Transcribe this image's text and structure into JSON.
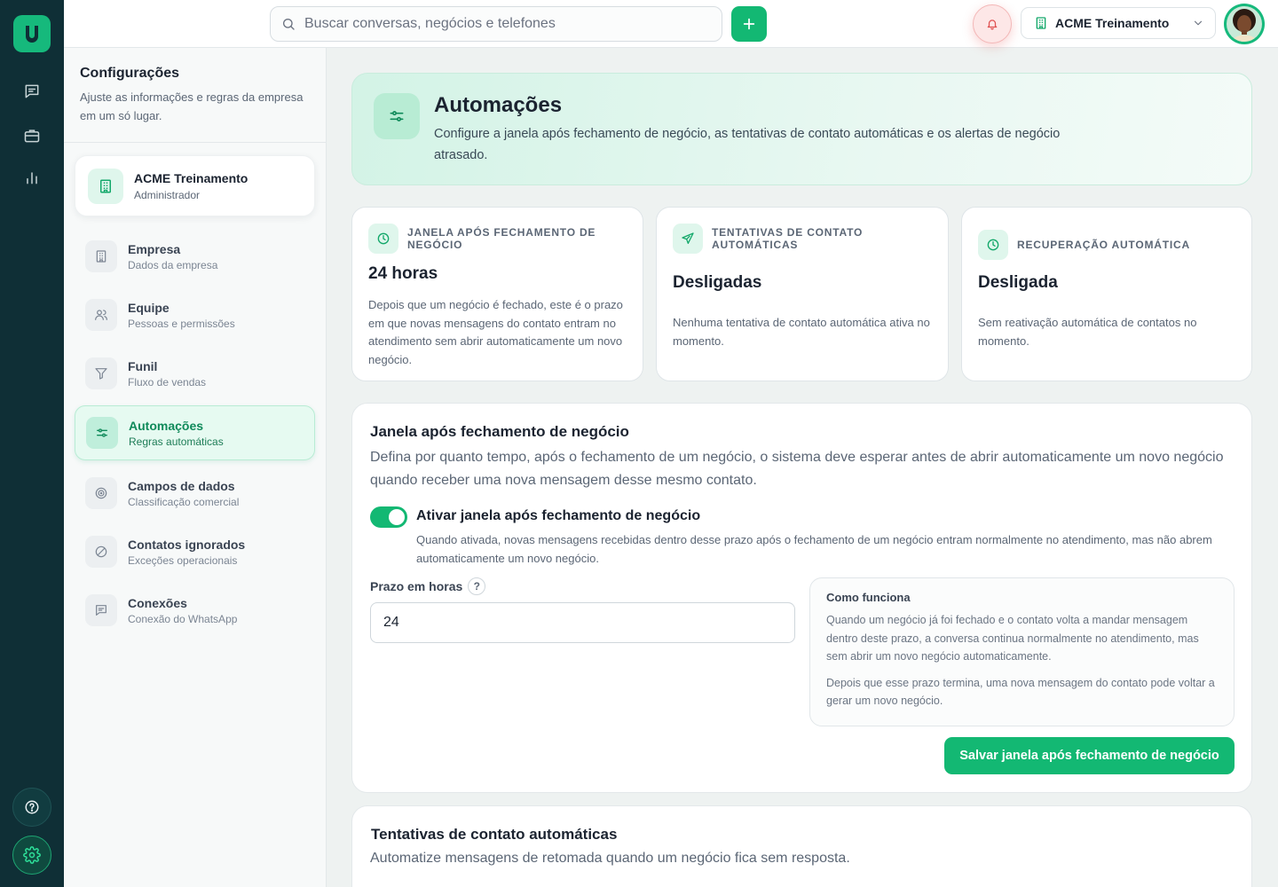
{
  "search": {
    "placeholder": "Buscar conversas, negócios e telefones"
  },
  "topbar": {
    "company_name": "ACME Treinamento"
  },
  "sidebar": {
    "title": "Configurações",
    "subtitle": "Ajuste as informações e regras da empresa em um só lugar.",
    "company": {
      "name": "ACME Treinamento",
      "role": "Administrador"
    },
    "items": [
      {
        "title": "Empresa",
        "subtitle": "Dados da empresa",
        "icon": "building-icon"
      },
      {
        "title": "Equipe",
        "subtitle": "Pessoas e permissões",
        "icon": "users-icon"
      },
      {
        "title": "Funil",
        "subtitle": "Fluxo de vendas",
        "icon": "filter-icon"
      },
      {
        "title": "Automações",
        "subtitle": "Regras automáticas",
        "icon": "sliders-icon",
        "active": true
      },
      {
        "title": "Campos de dados",
        "subtitle": "Classificação comercial",
        "icon": "target-icon"
      },
      {
        "title": "Contatos ignorados",
        "subtitle": "Exceções operacionais",
        "icon": "ban-icon"
      },
      {
        "title": "Conexões",
        "subtitle": "Conexão do WhatsApp",
        "icon": "chat-icon"
      }
    ]
  },
  "hero": {
    "title": "Automações",
    "description": "Configure a janela após fechamento de negócio, as tentativas de contato automáticas e os alertas de negócio atrasado."
  },
  "stats": [
    {
      "label": "Janela após fechamento de negócio",
      "value": "24 horas",
      "description": "Depois que um negócio é fechado, este é o prazo em que novas mensagens do contato entram no atendimento sem abrir automaticamente um novo negócio.",
      "icon": "clock-icon"
    },
    {
      "label": "Tentativas de contato automáticas",
      "value": "Desligadas",
      "description": "Nenhuma tentativa de contato automática ativa no momento.",
      "icon": "send-icon"
    },
    {
      "label": "Recuperação automática",
      "value": "Desligada",
      "description": "Sem reativação automática de contatos no momento.",
      "icon": "clock-icon"
    }
  ],
  "window_panel": {
    "title": "Janela após fechamento de negócio",
    "description": "Defina por quanto tempo, após o fechamento de um negócio, o sistema deve esperar antes de abrir automaticamente um novo negócio quando receber uma nova mensagem desse mesmo contato.",
    "toggle_title": "Ativar janela após fechamento de negócio",
    "toggle_description": "Quando ativada, novas mensagens recebidas dentro desse prazo após o fechamento de um negócio entram normalmente no atendimento, mas não abrem automaticamente um novo negócio.",
    "toggle_on": true,
    "field_label": "Prazo em horas",
    "help_mark": "?",
    "hours_value": "24",
    "how_title": "Como funciona",
    "how_p1": "Quando um negócio já foi fechado e o contato volta a mandar mensagem dentro deste prazo, a conversa continua normalmente no atendimento, mas sem abrir um novo negócio automaticamente.",
    "how_p2": "Depois que esse prazo termina, uma nova mensagem do contato pode voltar a gerar um novo negócio.",
    "save_label": "Salvar janela após fechamento de negócio"
  },
  "attempts_panel": {
    "title": "Tentativas de contato automáticas",
    "description": "Automatize mensagens de retomada quando um negócio fica sem resposta."
  },
  "colors": {
    "accent": "#13b873",
    "rail": "#0f2f36",
    "alert": "#e05252"
  }
}
